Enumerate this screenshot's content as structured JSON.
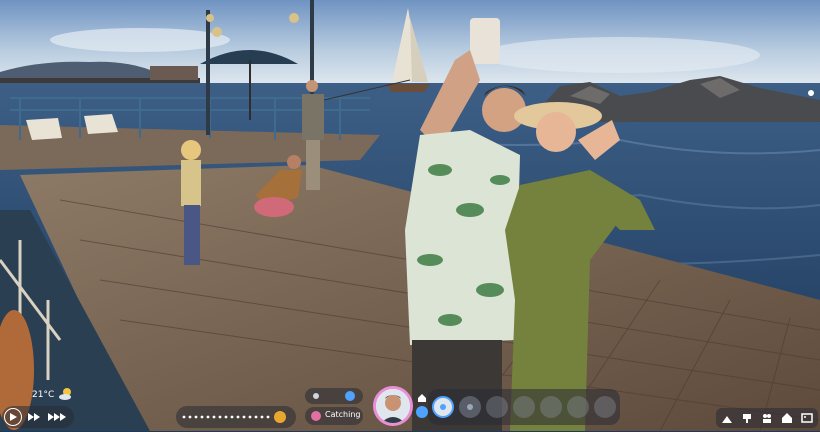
{
  "hud": {
    "temperature": "21°C",
    "current_action": "Catching",
    "weather_icon": "sun-cloud-icon",
    "colors": {
      "panel": "#2a2e36",
      "portrait_ring": "#e98fd6",
      "accent_blue": "#4ea3ff",
      "action_pill": "#e070a0"
    }
  },
  "playback": {
    "buttons": [
      "play-icon",
      "fast-forward-icon",
      "faster-forward-icon"
    ]
  },
  "bottom_right_tools": [
    "build-icon",
    "paint-icon",
    "family-icon",
    "household-icon",
    "gallery-icon"
  ]
}
